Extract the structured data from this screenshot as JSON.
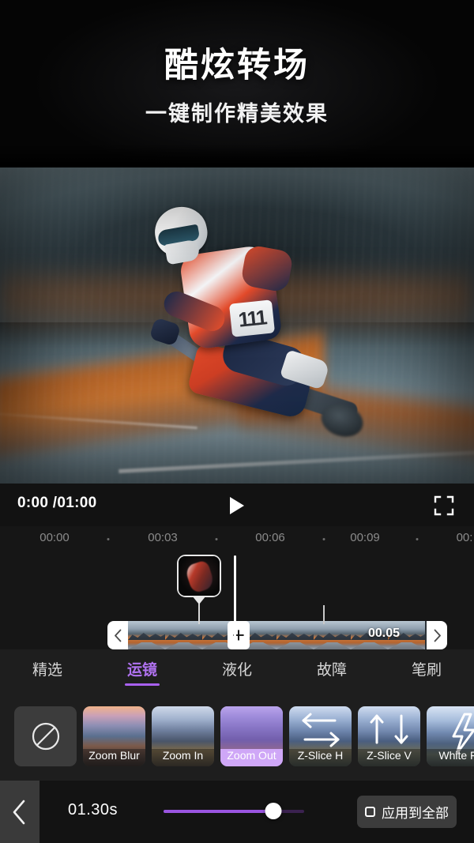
{
  "promo": {
    "title": "酷炫转场",
    "subtitle": "一键制作精美效果"
  },
  "player": {
    "time_current": "0:00",
    "time_separator": "/",
    "time_total": "01:00",
    "time_display": "0:00 /01:00",
    "play_icon": "play-icon",
    "fullscreen_icon": "fullscreen-icon"
  },
  "timeline": {
    "ruler_labels": [
      "00:00",
      "00:03",
      "00:06",
      "00:09",
      "00:"
    ],
    "clip_duration": "00.05",
    "add_transition_label": "+",
    "left_handle_icon": "chevron-left-icon",
    "right_handle_icon": "chevron-right-icon",
    "preview_bubble_icon": "frame-preview-thumbnail"
  },
  "tabs": {
    "active_index": 1,
    "items": [
      {
        "label": "精选"
      },
      {
        "label": "运镜"
      },
      {
        "label": "液化"
      },
      {
        "label": "故障"
      },
      {
        "label": "笔刷"
      }
    ],
    "active_color": "#b072f0",
    "underline_color": "#a861ef"
  },
  "effects": {
    "selected_index": 3,
    "items": [
      {
        "label": "",
        "icon": "no-effect-icon",
        "kind": "none"
      },
      {
        "label": "Zoom Blur",
        "icon": "",
        "kind": "scene-a"
      },
      {
        "label": "Zoom In",
        "icon": "",
        "kind": "scene-b"
      },
      {
        "label": "Zoom Out",
        "icon": "",
        "kind": "scene-c"
      },
      {
        "label": "Z-Slice H",
        "icon": "arrows-horizontal-icon",
        "kind": "scene-d"
      },
      {
        "label": "Z-Slice V",
        "icon": "arrows-vertical-icon",
        "kind": "scene-e"
      },
      {
        "label": "White F",
        "icon": "lightning-bolt-icon",
        "kind": "scene-f"
      }
    ],
    "selected_color": "#cfa7f7"
  },
  "bottom": {
    "back_icon": "chevron-left-icon",
    "duration_value": "01.30s",
    "slider_percent": 78,
    "slider_fill_color": "#9a55e0",
    "apply_all_label": "应用到全部",
    "apply_all_icon": "checkbox-unchecked-icon"
  }
}
